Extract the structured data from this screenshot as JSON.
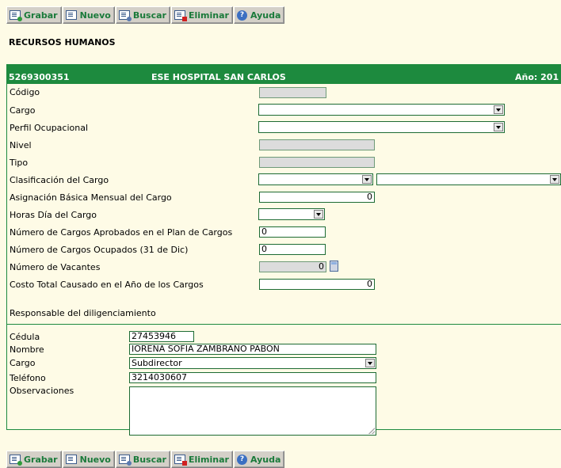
{
  "toolbar": {
    "grabar": "Grabar",
    "nuevo": "Nuevo",
    "buscar": "Buscar",
    "eliminar": "Eliminar",
    "ayuda": "Ayuda"
  },
  "page_title": "RECURSOS HUMANOS",
  "header": {
    "code": "5269300351",
    "entity": "ESE HOSPITAL SAN CARLOS",
    "year": "Año: 201"
  },
  "form": {
    "codigo": {
      "label": "Código",
      "value": ""
    },
    "cargo": {
      "label": "Cargo",
      "value": ""
    },
    "perfil": {
      "label": "Perfil Ocupacional",
      "value": ""
    },
    "nivel": {
      "label": "Nivel",
      "value": ""
    },
    "tipo": {
      "label": "Tipo",
      "value": ""
    },
    "clasificacion": {
      "label": "Clasificación del Cargo",
      "value1": "",
      "value2": ""
    },
    "asignacion": {
      "label": "Asignación Básica Mensual del Cargo",
      "value": "0"
    },
    "horas": {
      "label": "Horas Día del Cargo",
      "value": ""
    },
    "aprobados": {
      "label": "Número de Cargos Aprobados en el Plan de Cargos",
      "value": "0"
    },
    "ocupados": {
      "label": "Número de Cargos Ocupados (31 de Dic)",
      "value": "0"
    },
    "vacantes": {
      "label": "Número de Vacantes",
      "value": "0"
    },
    "costo": {
      "label": "Costo Total Causado en el Año de los Cargos",
      "value": "0"
    }
  },
  "responsable": {
    "section_label": "Responsable del diligenciamiento",
    "cedula": {
      "label": "Cédula",
      "value": "27453946"
    },
    "nombre": {
      "label": "Nombre",
      "value": "IORENA SOFIA ZAMBRANO PABON"
    },
    "cargo": {
      "label": "Cargo",
      "value": "Subdirector"
    },
    "telefono": {
      "label": "Teléfono",
      "value": "3214030607"
    },
    "observaciones": {
      "label": "Observaciones",
      "value": ""
    }
  },
  "icons": {
    "grabar": "save-icon",
    "nuevo": "new-icon",
    "buscar": "search-icon",
    "eliminar": "delete-icon",
    "ayuda": "help-icon",
    "vacantes": "calculator-icon"
  },
  "colors": {
    "accent": "#1d8a3e",
    "background": "#fefbe6",
    "toolbar_text": "#1a7a3a"
  }
}
